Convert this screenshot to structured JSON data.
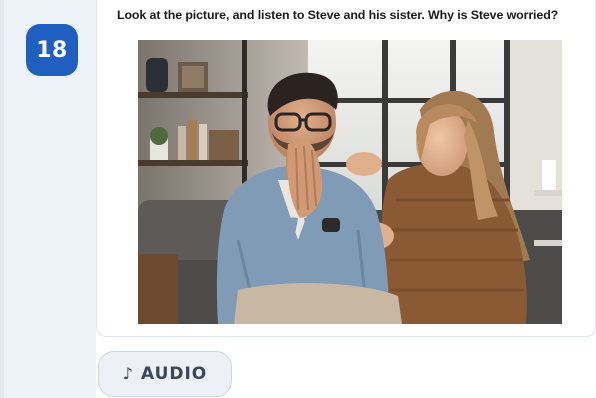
{
  "question": {
    "number": "18",
    "prompt": "Look at the picture, and listen to Steve and his sister. Why is Steve worried?"
  },
  "audio": {
    "icon": "music-note-icon",
    "icon_glyph": "♪",
    "label": "AUDIO"
  },
  "colors": {
    "badge": "#1f5fbf",
    "rail": "#eef2f9",
    "audio_button_bg": "#edf1f7",
    "audio_text": "#3b4658"
  }
}
